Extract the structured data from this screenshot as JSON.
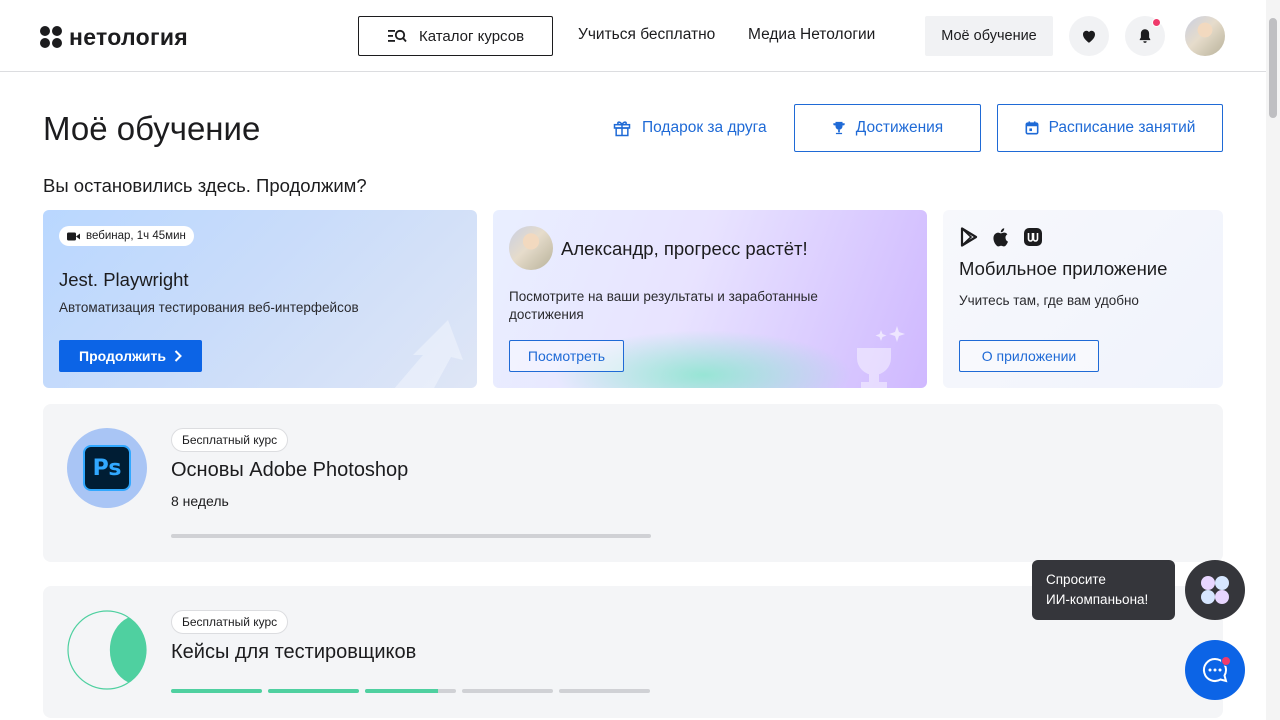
{
  "header": {
    "logo_text": "нетология",
    "catalog_label": "Каталог курсов",
    "nav": [
      "Учиться бесплатно",
      "Медиа Нетологии"
    ],
    "my_learning_label": "Моё обучение"
  },
  "page": {
    "title": "Моё обучение",
    "gift_label": "Подарок за друга",
    "achievements_label": "Достижения",
    "schedule_label": "Расписание занятий",
    "subtitle": "Вы остановились здесь. Продолжим?"
  },
  "cards": {
    "webinar": {
      "chip": "вебинар, 1ч 45мин",
      "title": "Jest. Playwright",
      "text": "Автоматизация тестирования веб-интерфейсов",
      "button": "Продолжить"
    },
    "progress": {
      "title": "Александр, прогресс растёт!",
      "text": "Посмотрите на ваши результаты и заработанные достижения",
      "button": "Посмотреть"
    },
    "app": {
      "title": "Мобильное приложение",
      "text": "Учитесь там, где вам удобно",
      "button": "О приложении"
    }
  },
  "courses": [
    {
      "badge": "Бесплатный курс",
      "title": "Основы Adobe Photoshop",
      "meta": "8 недель",
      "icon_text": "Ps",
      "progress": 0
    },
    {
      "badge": "Бесплатный курс",
      "title": "Кейсы для тестировщиков",
      "segments": [
        1,
        1,
        0.8,
        0,
        0
      ]
    }
  ],
  "ai_helper": {
    "line1": "Спросите",
    "line2": "ИИ-компаньона!"
  },
  "colors": {
    "accent": "#0c64e6",
    "link": "#1f6ad6",
    "notification": "#ef3a6b",
    "progress_green": "#4fd0a0"
  }
}
